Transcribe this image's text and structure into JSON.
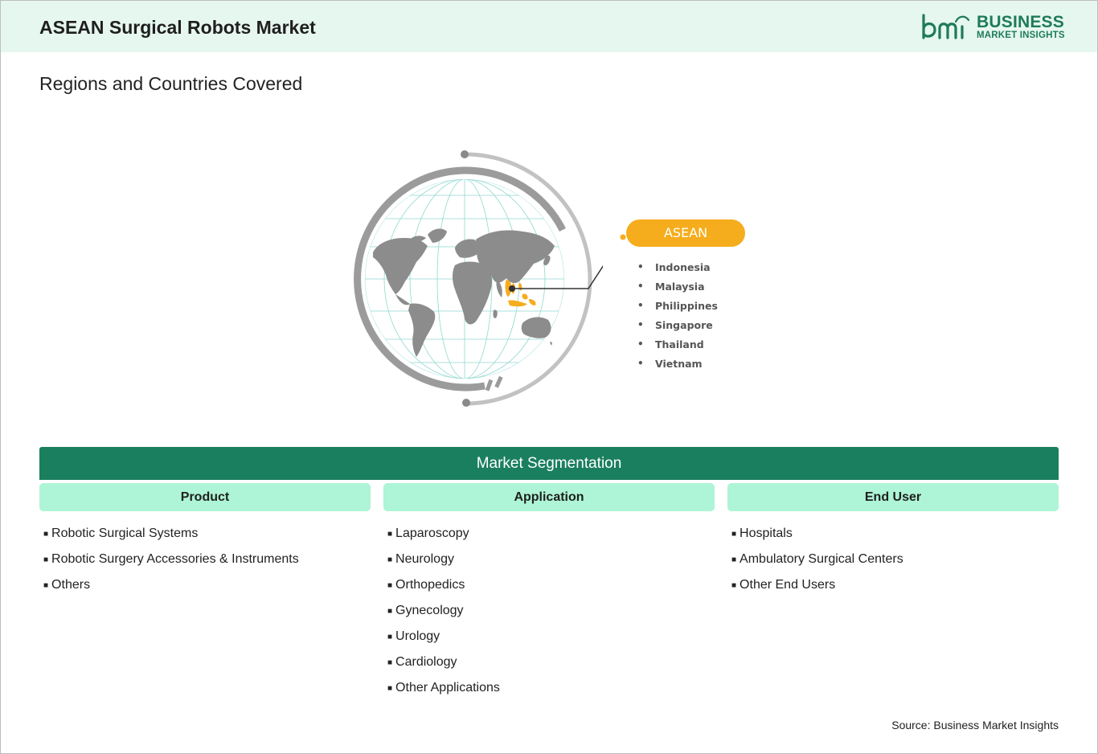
{
  "header": {
    "title": "ASEAN Surgical Robots Market",
    "logo": {
      "mark": "bmi",
      "line1": "BUSINESS",
      "line2": "MARKET INSIGHTS"
    }
  },
  "regions": {
    "title": "Regions and Countries Covered",
    "region_label": "ASEAN",
    "countries": [
      "Indonesia",
      "Malaysia",
      "Philippines",
      "Singapore",
      "Thailand",
      "Vietnam"
    ]
  },
  "segmentation": {
    "title": "Market Segmentation",
    "columns": [
      {
        "heading": "Product",
        "items": [
          "Robotic Surgical Systems",
          "Robotic Surgery Accessories & Instruments",
          "Others"
        ]
      },
      {
        "heading": "Application",
        "items": [
          "Laparoscopy",
          "Neurology",
          "Orthopedics",
          "Gynecology",
          "Urology",
          "Cardiology",
          "Other Applications"
        ]
      },
      {
        "heading": "End User",
        "items": [
          "Hospitals",
          "Ambulatory Surgical Centers",
          "Other End Users"
        ]
      }
    ]
  },
  "source": "Source: Business Market Insights",
  "colors": {
    "brand": "#1e7b5a",
    "header_bg": "#e6f7ef",
    "segment_bar": "#1a7f5e",
    "segment_head": "#adf5d6",
    "highlight": "#f5ad1d",
    "map_gray": "#8c8c8c"
  }
}
